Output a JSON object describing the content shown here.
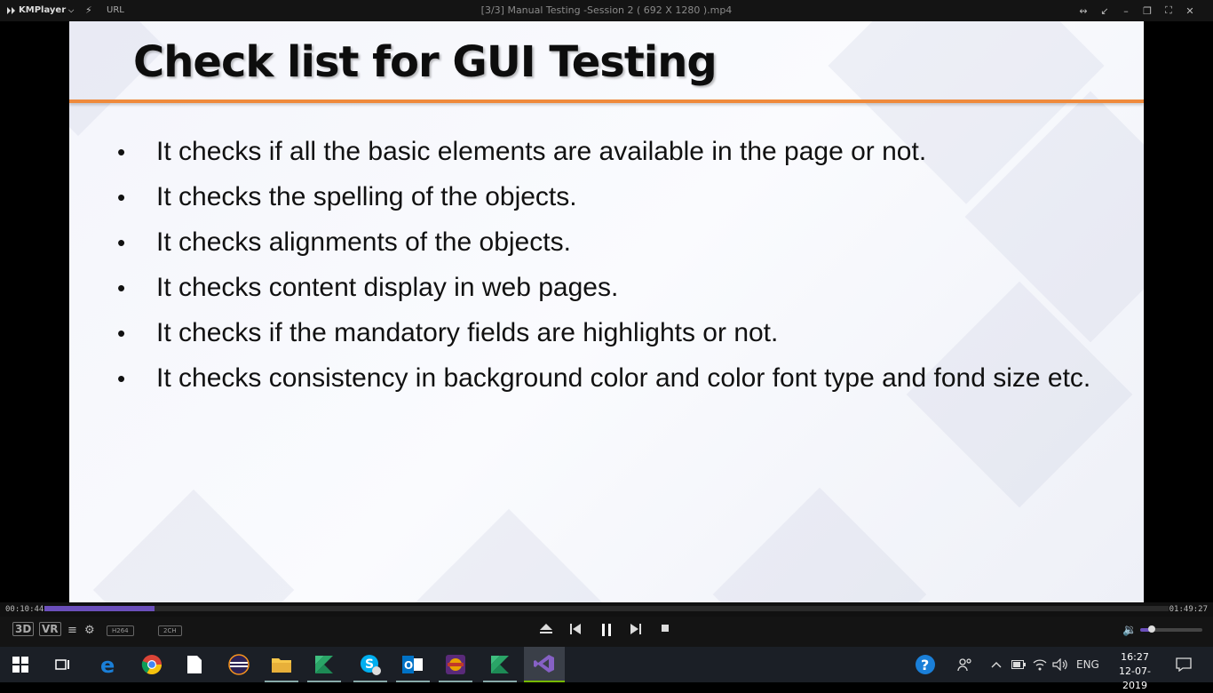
{
  "titlebar": {
    "app_name": "KMPlayer",
    "url_label": "URL",
    "window_title": "[3/3] Manual Testing -Session 2 ( 692 X 1280 ).mp4"
  },
  "slide": {
    "title": "Check list for GUI Testing",
    "bullets": [
      "It checks if all the basic elements are available in the page or not.",
      "It checks the spelling of the objects.",
      "It checks alignments of the objects.",
      "It checks content display in web pages.",
      "It checks if the mandatory fields are highlights or not.",
      "It checks consistency in background color and color font type and fond size etc."
    ],
    "accent_color": "#ef8a3c"
  },
  "player": {
    "elapsed": "00:10:44",
    "total": "01:49:27",
    "progress": 0.098,
    "volume": 0.18,
    "codec_badge": "H264",
    "channel_badge": "2CH",
    "mode_3d": "3D",
    "mode_vr": "VR",
    "accent_color": "#6b4fbb"
  },
  "taskbar": {
    "language": "ENG",
    "time": "16:27",
    "date": "12-07-2019",
    "apps": [
      "start-icon",
      "task-view-icon",
      "edge-icon",
      "chrome-icon",
      "file-icon",
      "eclipse-icon",
      "file-explorer-icon",
      "kotlin-icon",
      "skype-icon",
      "outlook-icon",
      "dev-tool-icon",
      "kotlin-ide-icon",
      "visual-studio-icon"
    ]
  }
}
